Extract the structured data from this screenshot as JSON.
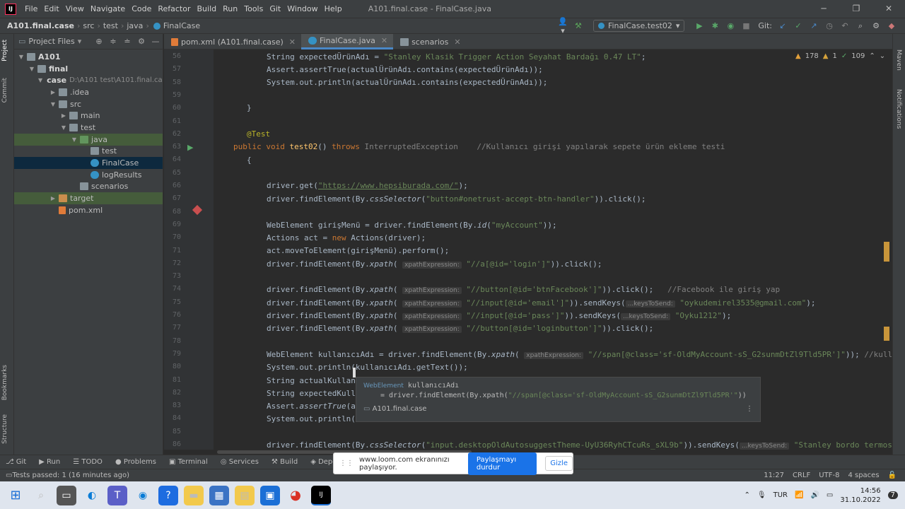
{
  "titlebar": {
    "menu": [
      "File",
      "Edit",
      "View",
      "Navigate",
      "Code",
      "Refactor",
      "Build",
      "Run",
      "Tools",
      "Git",
      "Window",
      "Help"
    ],
    "window_title": "A101.final.case - FinalCase.java",
    "controls": [
      "─",
      "❐",
      "✕"
    ]
  },
  "navbar": {
    "breadcrumb": [
      "A101.final.case",
      "src",
      "test",
      "java",
      "FinalCase"
    ],
    "run_config": "FinalCase.test02",
    "git_label": "Git:"
  },
  "left_strip": {
    "project": "Project",
    "commit": "Commit",
    "bookmarks": "Bookmarks",
    "structure": "Structure"
  },
  "right_strip": {
    "maven": "Maven",
    "notifications": "Notifications"
  },
  "project_panel": {
    "title": "Project Files",
    "tree": [
      {
        "name": "A101",
        "bold": true,
        "depth": 0,
        "expanded": true,
        "icon": "folder"
      },
      {
        "name": "final",
        "bold": true,
        "depth": 1,
        "expanded": true,
        "icon": "folder"
      },
      {
        "name": "case",
        "bold": true,
        "depth": 2,
        "expanded": true,
        "icon": "folder",
        "path": "D:\\A101 test\\A101.final.case"
      },
      {
        "name": ".idea",
        "depth": 3,
        "expanded": false,
        "icon": "folder"
      },
      {
        "name": "src",
        "depth": 3,
        "expanded": true,
        "icon": "folder"
      },
      {
        "name": "main",
        "depth": 4,
        "expanded": false,
        "icon": "folder"
      },
      {
        "name": "test",
        "depth": 4,
        "expanded": true,
        "icon": "folder"
      },
      {
        "name": "java",
        "depth": 5,
        "expanded": true,
        "icon": "test",
        "highlight": "green"
      },
      {
        "name": "test",
        "depth": 6,
        "icon": "folder"
      },
      {
        "name": "FinalCase",
        "depth": 6,
        "icon": "java",
        "highlight": "sel"
      },
      {
        "name": "logResults",
        "depth": 6,
        "icon": "java"
      },
      {
        "name": "scenarios",
        "depth": 5,
        "icon": "folder"
      },
      {
        "name": "target",
        "depth": 3,
        "expanded": false,
        "icon": "excl",
        "highlight": "green"
      },
      {
        "name": "pom.xml",
        "depth": 3,
        "icon": "xml"
      }
    ]
  },
  "tabs": [
    {
      "label": "pom.xml (A101.final.case)",
      "active": false
    },
    {
      "label": "FinalCase.java",
      "active": true
    },
    {
      "label": "scenarios",
      "active": false
    }
  ],
  "inspections": {
    "warnings": "178",
    "errors": "1",
    "weak": "109"
  },
  "line_numbers": [
    "56",
    "57",
    "58",
    "59",
    "60",
    "61",
    "62",
    "63",
    "64",
    "65",
    "66",
    "67",
    "68",
    "69",
    "70",
    "71",
    "72",
    "73",
    "74",
    "75",
    "76",
    "77",
    "78",
    "79",
    "80",
    "81",
    "82",
    "83",
    "84",
    "85",
    "86"
  ],
  "code": {
    "l56_a": "String expectedÜrünAdı = ",
    "l56_b": "\"Stanley Klasik Trigger Action Seyahat Bardağı 0.47 LT\"",
    "l57": "Assert.assertTrue(actualÜrünAdı.contains(expectedÜrünAdı));",
    "l58": "System.out.println(actualÜrünAdı.contains(expectedÜrünAdı));",
    "l60": "}",
    "l62": "@Test",
    "l63_kw": "public void ",
    "l63_fn": "test02",
    "l63_b": "() ",
    "l63_throws": "throws ",
    "l63_ex": "InterruptedException",
    "l63_cm": "//Kullanıcı girişi yapılarak sepete ürün ekleme testi",
    "l64": "{",
    "l66_a": "driver.get(",
    "l66_s": "\"https://www.hepsiburada.com/\"",
    "l66_b": ");",
    "l67_a": "driver.findElement(By.",
    "l67_m": "cssSelector",
    "l67_s": "\"button#onetrust-accept-btn-handler\"",
    "l67_b": ")).click();",
    "l69_a": "WebElement girişMenü = driver.findElement(By.",
    "l69_m": "id",
    "l69_s": "\"myAccount\"",
    "l69_b": "));",
    "l70_a": "Actions act = ",
    "l70_kw": "new ",
    "l70_b": "Actions(driver);",
    "l71": "act.moveToElement(girişMenü).perform();",
    "l72_a": "driver.findElement(By.",
    "l72_m": "xpath",
    "hint_xpath": "xpathExpression:",
    "hint_keys": "...keysToSend:",
    "l72_s": "\"//a[@id='login']\"",
    "l72_b": ")).click();",
    "l74_s": "\"//button[@id='btnFacebook']\"",
    "l74_b": ")).click();   ",
    "l74_cm": "//Facebook ile giriş yap",
    "l75_s": "\"//input[@id='email']\"",
    "l75_b": ")).sendKeys(",
    "l75_v": "\"oykudemirel3535@gmail.com\"",
    "l75_c": ");",
    "l76_s": "\"//input[@id='pass']\"",
    "l76_v": "\"Oyku1212\"",
    "l77_s": "\"//button[@id='loginbutton']\"",
    "l79_a": "WebElement kullanıcıAdı = driver.findElement(By.",
    "l79_s": "\"//span[@class='sf-OldMyAccount-sS_G2sunmDtZl9Tld5PR']\"",
    "l79_b": ")); ",
    "l79_cm": "//kulla",
    "l80": "System.out.println(kullanıcıAdı.getText());",
    "l81": "String actualKullan",
    "l82": "String expectedKull",
    "l83_a": "Assert.",
    "l83_m": "assertTrue",
    "l83_b": "(a",
    "l84": "System.out.println(",
    "l86_a": "driver.findElement(By.",
    "l86_m": "cssSelector",
    "l86_s": "\"input.desktopOldAutosuggestTheme-UyU36RyhCTcuRs_sXL9b\"",
    "l86_b": ")).sendKeys(",
    "l86_v": "\"Stanley bordo termos"
  },
  "popup": {
    "type": "WebElement",
    "name": "kullanıcıAdı",
    "line2_a": "= driver.findElement(By.xpath(",
    "line2_s": "\"//span[@class='sf-OldMyAccount-sS_G2sunmDtZl9Tld5PR'\"",
    "line2_b": "))",
    "module": "A101.final.case"
  },
  "toolwindows": [
    "Git",
    "Run",
    "TODO",
    "Problems",
    "Terminal",
    "Services",
    "Build",
    "Dependen"
  ],
  "status": {
    "message": "Tests passed: 1 (16 minutes ago)",
    "position": "11:27",
    "line_sep": "CRLF",
    "encoding": "UTF-8",
    "indent": "4 spaces"
  },
  "loom": {
    "text": "www.loom.com ekranınızı paylaşıyor.",
    "stop": "Paylaşmayı durdur",
    "hide": "Gizle"
  },
  "taskbar": {
    "lang": "TUR",
    "time": "14:56",
    "date": "31.10.2022",
    "badge": "7"
  },
  "colors": {
    "keyword": "#cc7832",
    "string": "#6a8759",
    "annotation": "#bbb529",
    "comment": "#808080",
    "accent": "#4a88c7",
    "breakpoint": "#c94f4f"
  }
}
